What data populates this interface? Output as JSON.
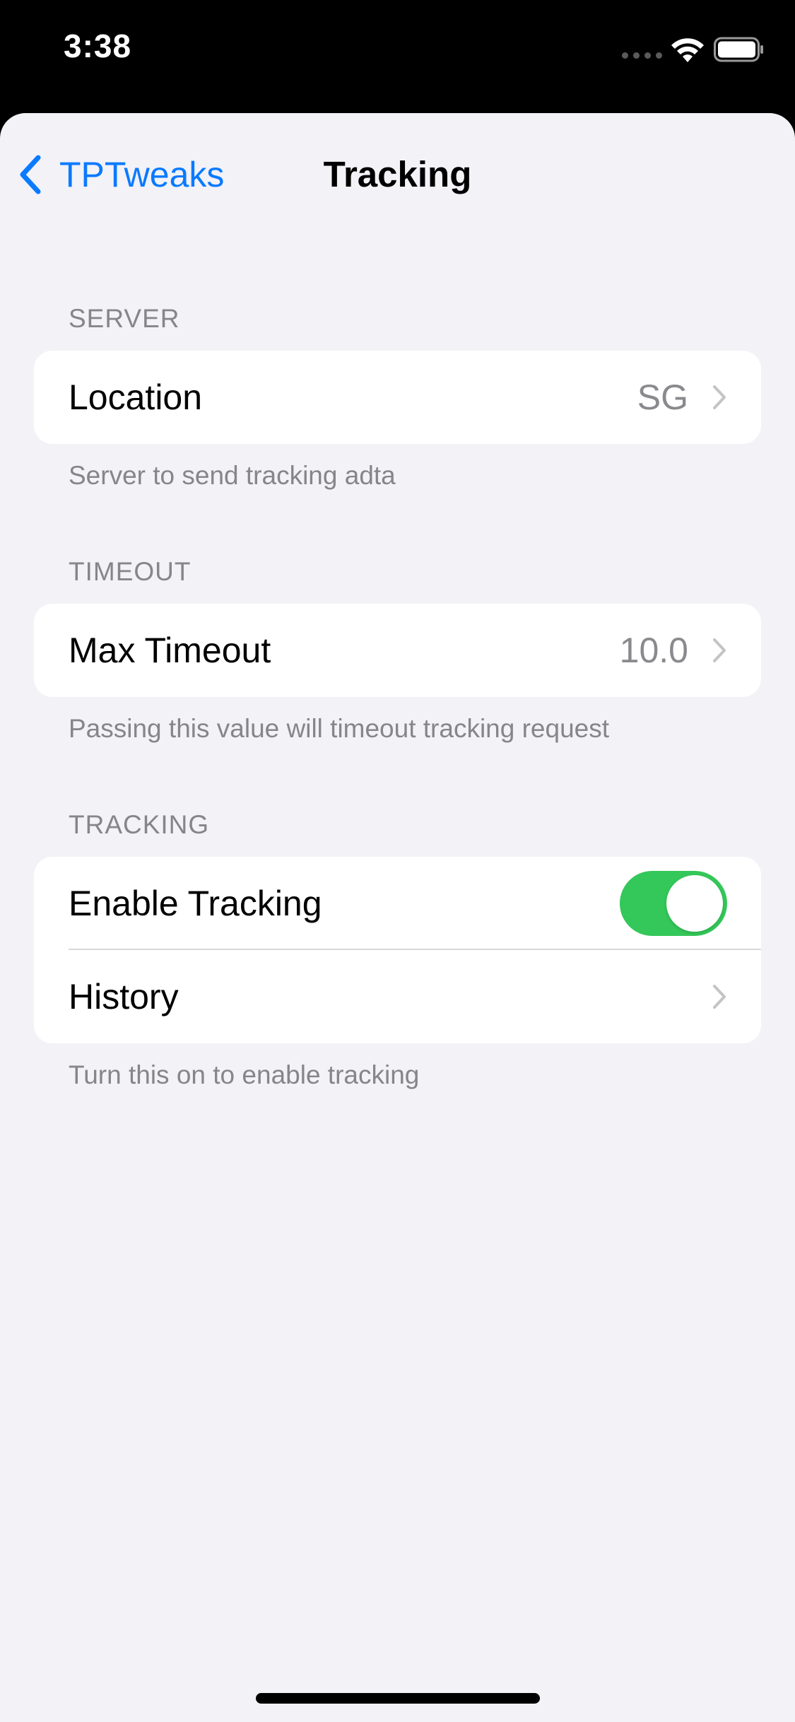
{
  "status_bar": {
    "time": "3:38"
  },
  "nav": {
    "back_label": "TPTweaks",
    "title": "Tracking"
  },
  "sections": [
    {
      "header": "SERVER",
      "rows": [
        {
          "label": "Location",
          "value": "SG",
          "accessory": "chevron"
        }
      ],
      "footer": "Server to send tracking adta"
    },
    {
      "header": "TIMEOUT",
      "rows": [
        {
          "label": "Max Timeout",
          "value": "10.0",
          "accessory": "chevron"
        }
      ],
      "footer": "Passing this value will timeout tracking request"
    },
    {
      "header": "TRACKING",
      "rows": [
        {
          "label": "Enable Tracking",
          "accessory": "toggle",
          "toggle_on": true
        },
        {
          "label": "History",
          "accessory": "chevron"
        }
      ],
      "footer": "Turn this on to enable tracking"
    }
  ],
  "colors": {
    "accent": "#0a7aff",
    "toggle_on": "#34c759",
    "background": "#f2f2f7",
    "secondary_text": "#85858b"
  },
  "icons": {
    "back": "chevron-left-icon",
    "disclosure": "chevron-right-icon",
    "wifi": "wifi-icon",
    "battery": "battery-icon",
    "signal": "signal-icon"
  }
}
